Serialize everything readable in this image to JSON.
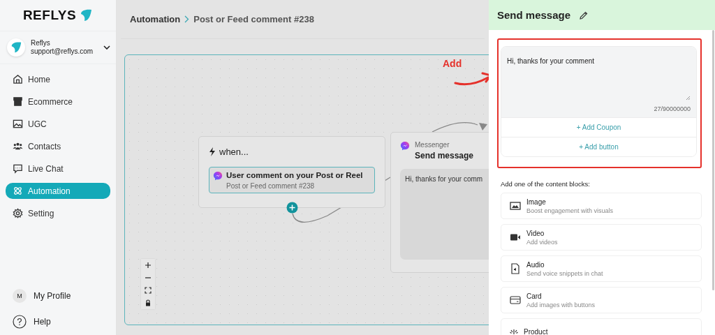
{
  "logo": {
    "text": "REFLYS"
  },
  "account": {
    "name": "Reflys",
    "email": "support@reflys.com"
  },
  "nav": [
    {
      "label": "Home",
      "selected": false
    },
    {
      "label": "Ecommerce",
      "selected": false
    },
    {
      "label": "UGC",
      "selected": false
    },
    {
      "label": "Contacts",
      "selected": false
    },
    {
      "label": "Live Chat",
      "selected": false
    },
    {
      "label": "Automation",
      "selected": true
    },
    {
      "label": "Setting",
      "selected": false
    }
  ],
  "profile": {
    "initial": "M",
    "label": "My Profile"
  },
  "help": {
    "label": "Help"
  },
  "breadcrumb": [
    "Automation",
    "Post or Feed comment #238"
  ],
  "canvas": {
    "trigger": {
      "title": "when...",
      "event_title": "User comment on your Post or Reel",
      "event_subtitle": "Post or Feed comment #238"
    },
    "action": {
      "channel": "Messenger",
      "title": "Send message",
      "preview": "Hi, thanks for your comm"
    },
    "annotation": "Add"
  },
  "panel": {
    "title": "Send message",
    "message": {
      "value": "Hi, thanks for your comment",
      "counter": "27/90000000"
    },
    "actions": [
      "+ Add Coupon",
      "+ Add button"
    ],
    "blocks_label": "Add one of the content blocks:",
    "blocks": [
      {
        "title": "Image",
        "description": "Boost engagement with visuals"
      },
      {
        "title": "Video",
        "description": "Add videos"
      },
      {
        "title": "Audio",
        "description": "Send voice snippets in chat"
      },
      {
        "title": "Card",
        "description": "Add images with buttons"
      },
      {
        "title": "Product"
      }
    ]
  }
}
